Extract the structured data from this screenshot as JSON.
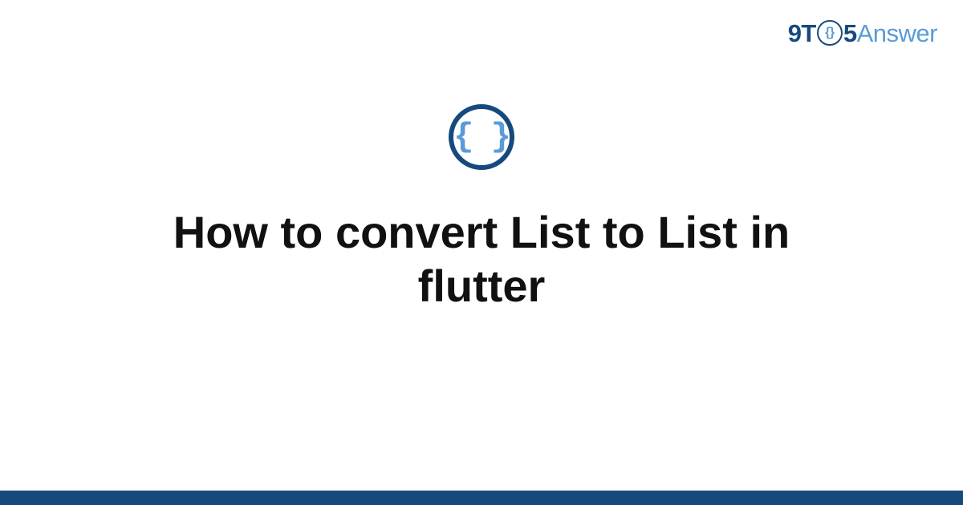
{
  "logo": {
    "part1": "9T",
    "circle_inner": "{}",
    "part2": "5",
    "part3": "Answer"
  },
  "category": {
    "icon_symbol": "{ }"
  },
  "title": "How to convert List to List in flutter"
}
